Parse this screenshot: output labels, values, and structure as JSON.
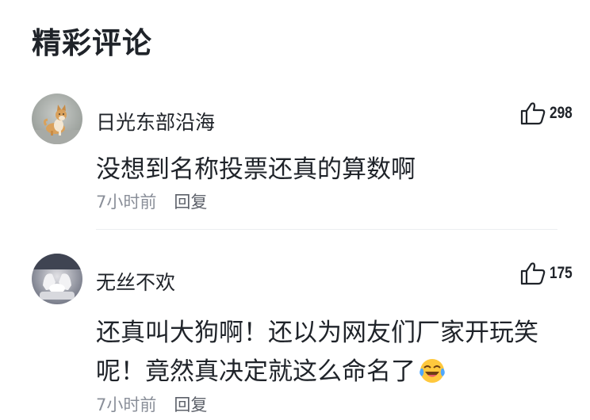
{
  "section": {
    "title": "精彩评论"
  },
  "comments": [
    {
      "username": "日光东部沿海",
      "avatar": "shiba-dog-avatar",
      "likes": "298",
      "text": "没想到名称投票还真的算数啊",
      "time": "7小时前",
      "reply_label": "回复"
    },
    {
      "username": "无丝不欢",
      "avatar": "hands-avatar",
      "likes": "175",
      "text": "还真叫大狗啊！还以为网友们厂家开玩笑呢！竟然真决定就这么命名了",
      "emoji": "laugh-cry-emoji",
      "time": "7小时前",
      "reply_label": "回复"
    }
  ],
  "colors": {
    "text": "#1f2329",
    "meta": "#8a8f99",
    "divider": "#eceef1"
  }
}
